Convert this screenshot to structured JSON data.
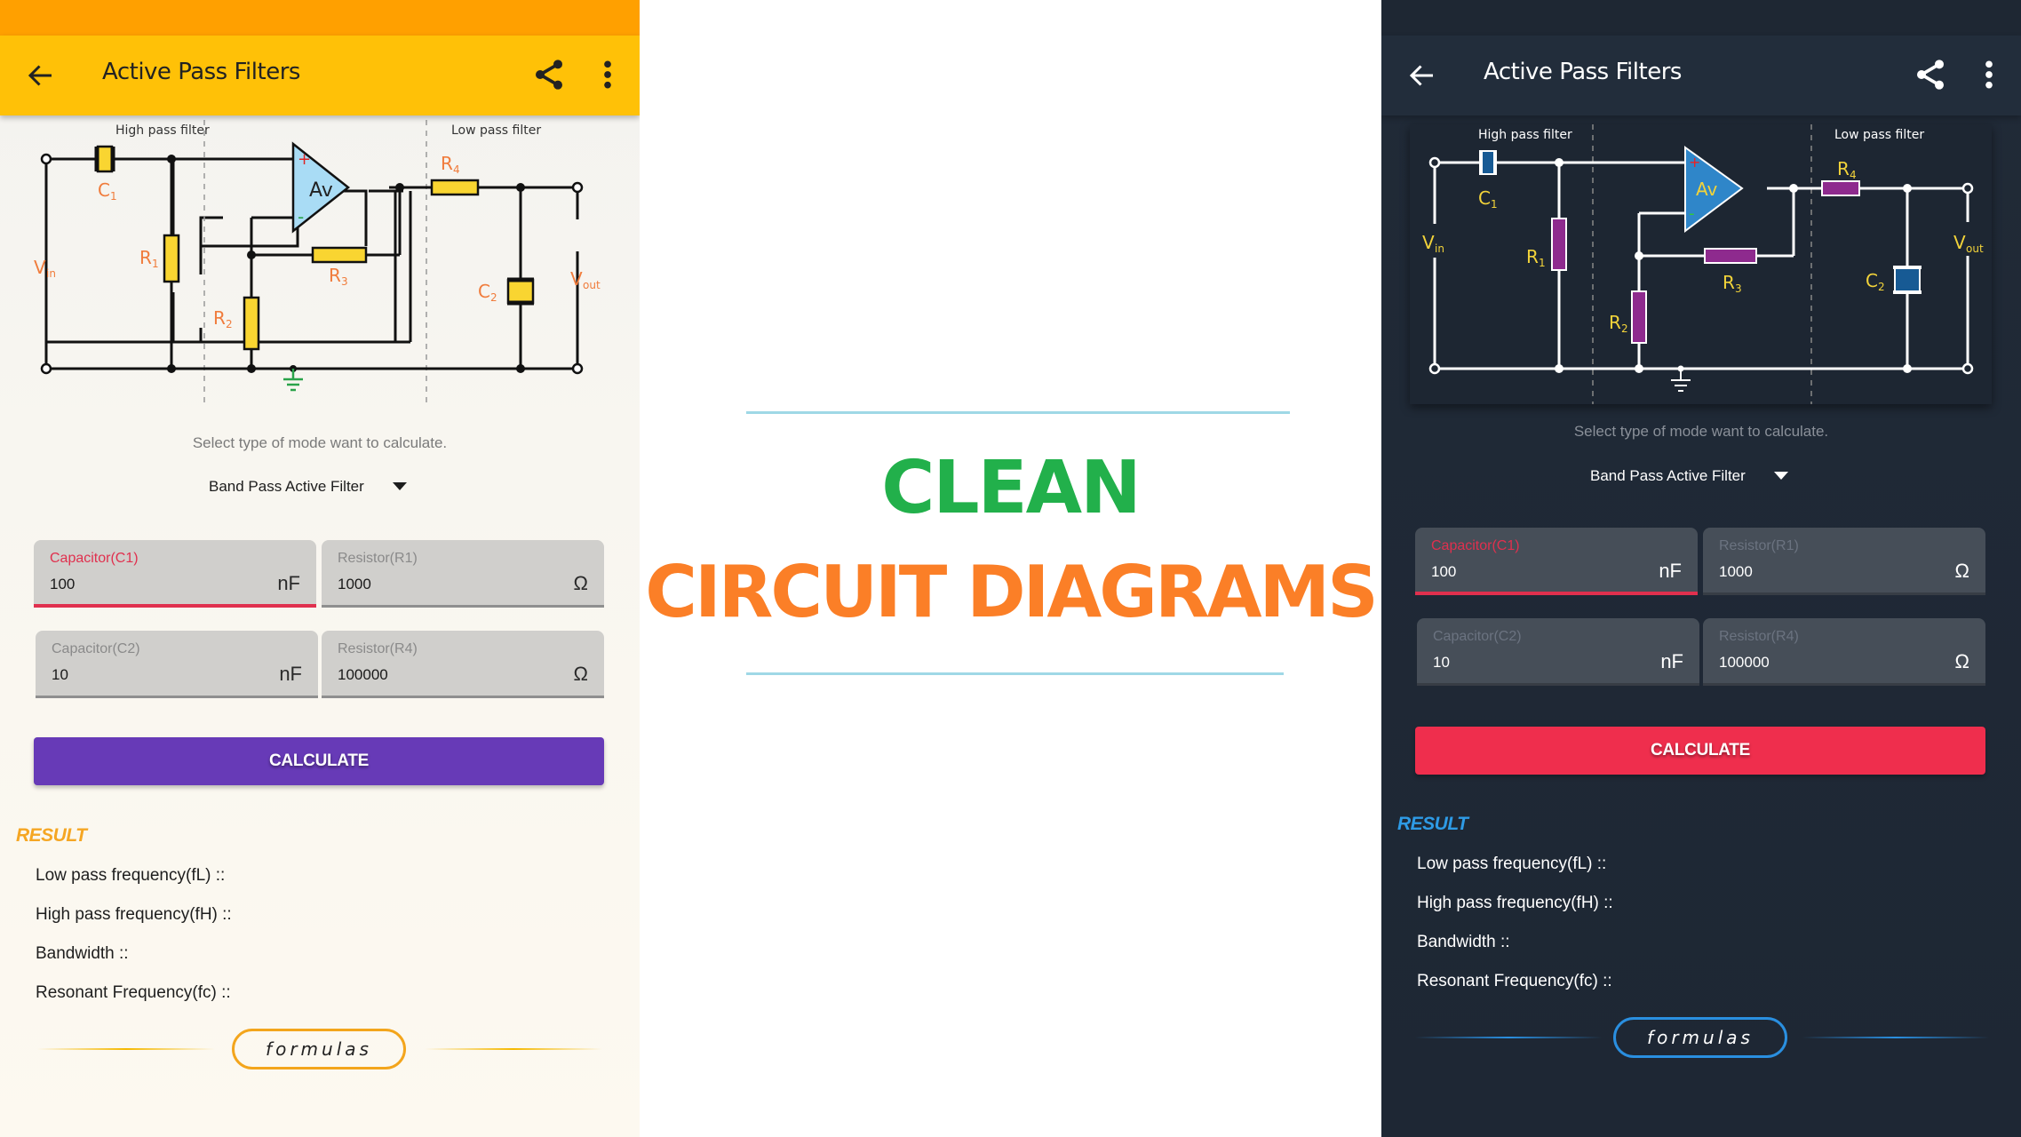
{
  "screens": {
    "light": {
      "toolbar": {
        "title": "Active Pass Filters",
        "back_icon": "arrow-left",
        "share_icon": "share",
        "menu_icon": "more-vertical"
      },
      "circuit": {
        "high_pass_label": "High pass filter",
        "low_pass_label": "Low pass filter",
        "opamp_label": "Av",
        "components": {
          "c1": "C",
          "c1_sub": "1",
          "c2": "C",
          "c2_sub": "2",
          "r1": "R",
          "r1_sub": "1",
          "r2": "R",
          "r2_sub": "2",
          "r3": "R",
          "r3_sub": "3",
          "r4": "R",
          "r4_sub": "4",
          "vin": "V",
          "vin_sub": "in",
          "vout": "V",
          "vout_sub": "out",
          "plus": "+",
          "minus": "-"
        },
        "colors": {
          "component_fill": "#f9d531",
          "label": "#f07c3c",
          "wire": "#111111",
          "opamp_fill": "#a9dcf5",
          "ground": "#2aa34a"
        }
      },
      "hint": "Select type of mode want to calculate.",
      "mode_select": {
        "selected": "Band Pass Active Filter"
      },
      "fields": [
        {
          "label": "Capacitor(C1)",
          "value": "100",
          "unit": "nF",
          "focused": true
        },
        {
          "label": "Resistor(R1)",
          "value": "1000",
          "unit": "Ω",
          "focused": false
        },
        {
          "label": "Capacitor(C2)",
          "value": "10",
          "unit": "nF",
          "focused": false
        },
        {
          "label": "Resistor(R4)",
          "value": "100000",
          "unit": "Ω",
          "focused": false
        }
      ],
      "calculate_label": "CALCULATE",
      "result": {
        "heading": "RESULT",
        "lines": [
          "Low pass frequency(fL) ::",
          "High pass frequency(fH) ::",
          "Bandwidth ::",
          "Resonant Frequency(fc) ::"
        ]
      },
      "formulas_label": "formulas",
      "colors": {
        "statusbar": "#ffa000",
        "toolbar": "#ffc107",
        "button": "#673ab7",
        "accent": "#e0304e",
        "result_heading": "#f5a623"
      }
    },
    "dark": {
      "toolbar": {
        "title": "Active Pass Filters",
        "back_icon": "arrow-left",
        "share_icon": "share",
        "menu_icon": "more-vertical"
      },
      "circuit": {
        "high_pass_label": "High pass filter",
        "low_pass_label": "Low pass filter",
        "opamp_label": "Av",
        "components": {
          "c1": "C",
          "c1_sub": "1",
          "c2": "C",
          "c2_sub": "2",
          "r1": "R",
          "r1_sub": "1",
          "r2": "R",
          "r2_sub": "2",
          "r3": "R",
          "r3_sub": "3",
          "r4": "R",
          "r4_sub": "4",
          "vin": "V",
          "vin_sub": "in",
          "vout": "V",
          "vout_sub": "out",
          "plus": "+",
          "minus": "-"
        },
        "colors": {
          "component_fill": "#8e2a8e",
          "capacitor_fill": "#175a94",
          "label": "#f2d33a",
          "wire": "#ffffff",
          "opamp_fill": "#2f86c9",
          "ground": "#ffffff"
        }
      },
      "hint": "Select type of mode want to calculate.",
      "mode_select": {
        "selected": "Band Pass Active Filter"
      },
      "fields": [
        {
          "label": "Capacitor(C1)",
          "value": "100",
          "unit": "nF",
          "focused": true
        },
        {
          "label": "Resistor(R1)",
          "value": "1000",
          "unit": "Ω",
          "focused": false
        },
        {
          "label": "Capacitor(C2)",
          "value": "10",
          "unit": "nF",
          "focused": false
        },
        {
          "label": "Resistor(R4)",
          "value": "100000",
          "unit": "Ω",
          "focused": false
        }
      ],
      "calculate_label": "CALCULATE",
      "result": {
        "heading": "RESULT",
        "lines": [
          "Low pass frequency(fL) ::",
          "High pass frequency(fH) ::",
          "Bandwidth ::",
          "Resonant Frequency(fc) ::"
        ]
      },
      "formulas_label": "formulas",
      "colors": {
        "statusbar": "#1e2733",
        "toolbar": "#222d3b",
        "button": "#ef2e4d",
        "accent": "#e0304e",
        "result_heading": "#2e9be6"
      }
    }
  },
  "promo": {
    "line1": "CLEAN",
    "line2": "CIRCUIT DIAGRAMS",
    "colors": {
      "line1": "#22b04b",
      "line2": "#fb7f27",
      "rule": "#9fd8e6"
    }
  }
}
